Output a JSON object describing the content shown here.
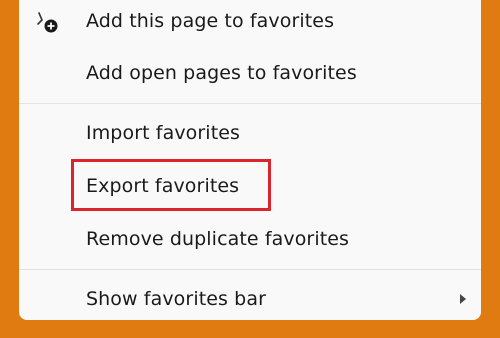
{
  "menu": {
    "items": [
      {
        "label": "Add this page to favorites",
        "icon": "star-add-icon"
      },
      {
        "label": "Add open pages to favorites"
      },
      {
        "label": "Import favorites"
      },
      {
        "label": "Export favorites",
        "highlighted": true
      },
      {
        "label": "Remove duplicate favorites"
      },
      {
        "label": "Show favorites bar",
        "submenu": true
      }
    ]
  },
  "colors": {
    "frame": "#e07b12",
    "menu_background": "#f9f9f9",
    "highlight": "#d8262c",
    "text": "#1a1a1a"
  }
}
